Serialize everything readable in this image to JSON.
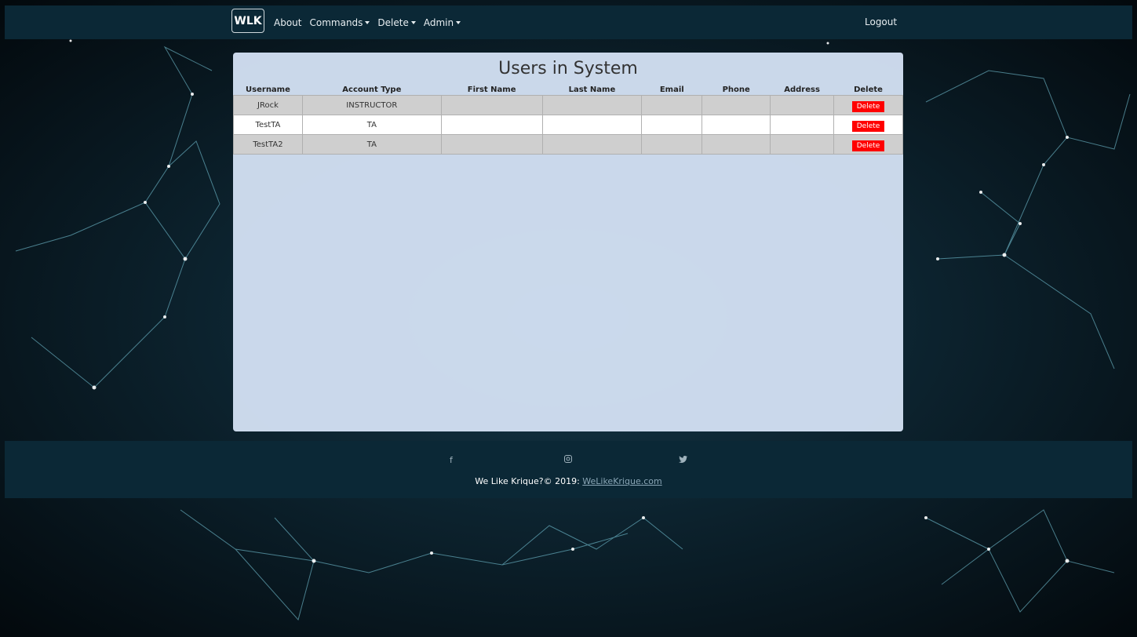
{
  "navbar": {
    "brand": "WLK",
    "items": [
      {
        "label": "About",
        "dropdown": false
      },
      {
        "label": "Commands",
        "dropdown": true
      },
      {
        "label": "Delete",
        "dropdown": true
      },
      {
        "label": "Admin",
        "dropdown": true
      }
    ],
    "logout": "Logout"
  },
  "panel": {
    "title": "Users in System",
    "columns": [
      "Username",
      "Account Type",
      "First Name",
      "Last Name",
      "Email",
      "Phone",
      "Address",
      "Delete"
    ],
    "rows": [
      {
        "username": "JRock",
        "account_type": "INSTRUCTOR",
        "first_name": "",
        "last_name": "",
        "email": "",
        "phone": "",
        "address": "",
        "delete_label": "Delete"
      },
      {
        "username": "TestTA",
        "account_type": "TA",
        "first_name": "",
        "last_name": "",
        "email": "",
        "phone": "",
        "address": "",
        "delete_label": "Delete"
      },
      {
        "username": "TestTA2",
        "account_type": "TA",
        "first_name": "",
        "last_name": "",
        "email": "",
        "phone": "",
        "address": "",
        "delete_label": "Delete"
      }
    ]
  },
  "footer": {
    "social_icons": [
      "facebook-icon",
      "instagram-icon",
      "twitter-icon"
    ],
    "text": "We Like Krique?© 2019: ",
    "link_text": "WeLikeKrique.com"
  },
  "colors": {
    "navbar_bg": "#0b2836",
    "delete_button": "#ff0000",
    "panel_bg": "#d2e0f2"
  }
}
